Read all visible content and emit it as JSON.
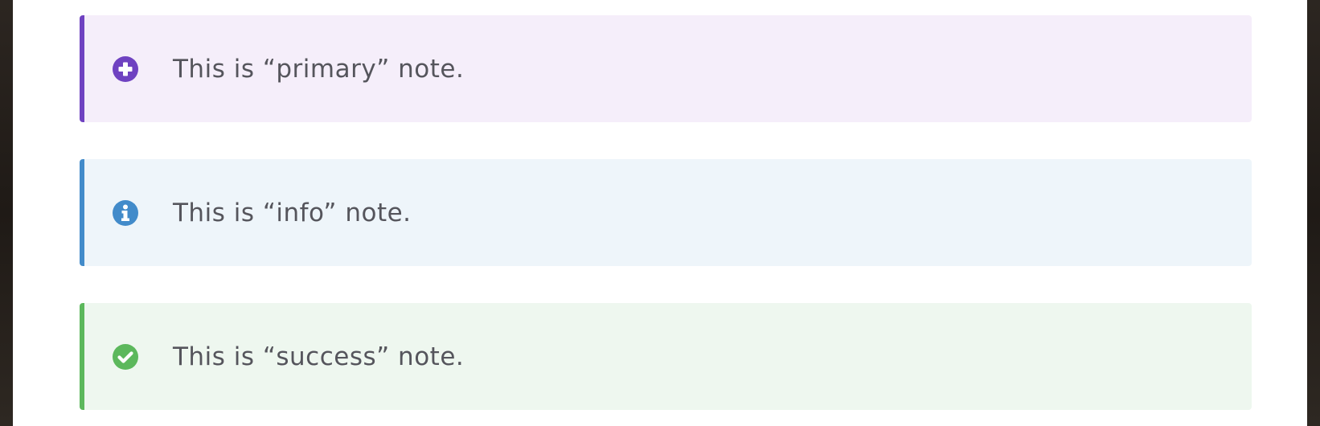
{
  "notes": [
    {
      "kind": "primary",
      "text": "This is “primary” note.",
      "icon": "plus-circle-icon",
      "accent_color": "#6f42c1",
      "background_color": "#f5eefa"
    },
    {
      "kind": "info",
      "text": "This is “info” note.",
      "icon": "info-circle-icon",
      "accent_color": "#428bca",
      "background_color": "#eef5fa"
    },
    {
      "kind": "success",
      "text": "This is “success” note.",
      "icon": "check-circle-icon",
      "accent_color": "#5cb85c",
      "background_color": "#eef7ef"
    }
  ]
}
